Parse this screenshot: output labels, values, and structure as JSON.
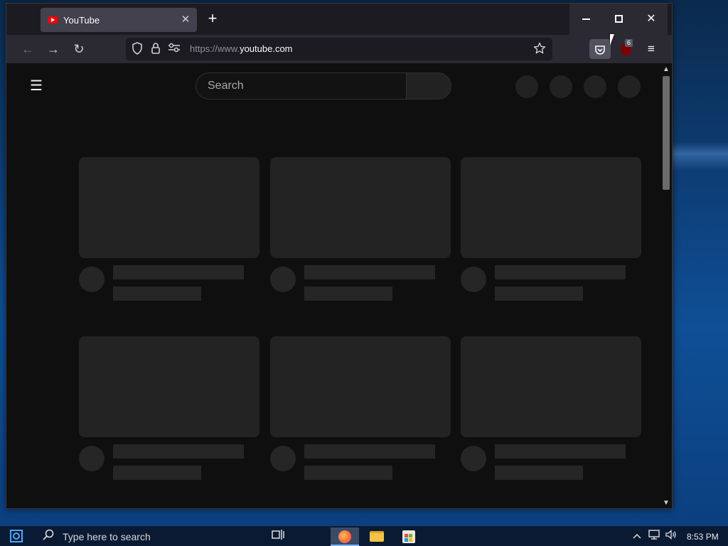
{
  "browser": {
    "tab": {
      "title": "YouTube",
      "close": "✕"
    },
    "new_tab": "+",
    "window_controls": {
      "close": "✕"
    },
    "nav": {
      "back": "←",
      "forward": "→",
      "reload": "↻"
    },
    "url": {
      "prefix": "https://www.",
      "host": "youtube.com"
    },
    "ublock_badge": "6",
    "menu": "≡"
  },
  "youtube": {
    "menu": "☰",
    "search_placeholder": "Search",
    "header_circles": 4,
    "cards": 6
  },
  "taskbar": {
    "search_placeholder": "Type here to search",
    "clock": "8:53 PM"
  },
  "icons": [
    "youtube-favicon-icon",
    "shield-icon",
    "lock-icon",
    "permissions-icon",
    "star-icon",
    "pocket-icon",
    "ublock-icon",
    "hamburger-menu-icon",
    "windows-start-icon",
    "search-icon",
    "task-view-icon",
    "firefox-icon",
    "file-explorer-icon",
    "store-icon",
    "chevron-up-icon",
    "network-icon",
    "volume-icon"
  ],
  "colors": {
    "youtube_red": "#ff0000",
    "placeholder": "#232323",
    "firefox_toolbar": "#2b2a33"
  }
}
